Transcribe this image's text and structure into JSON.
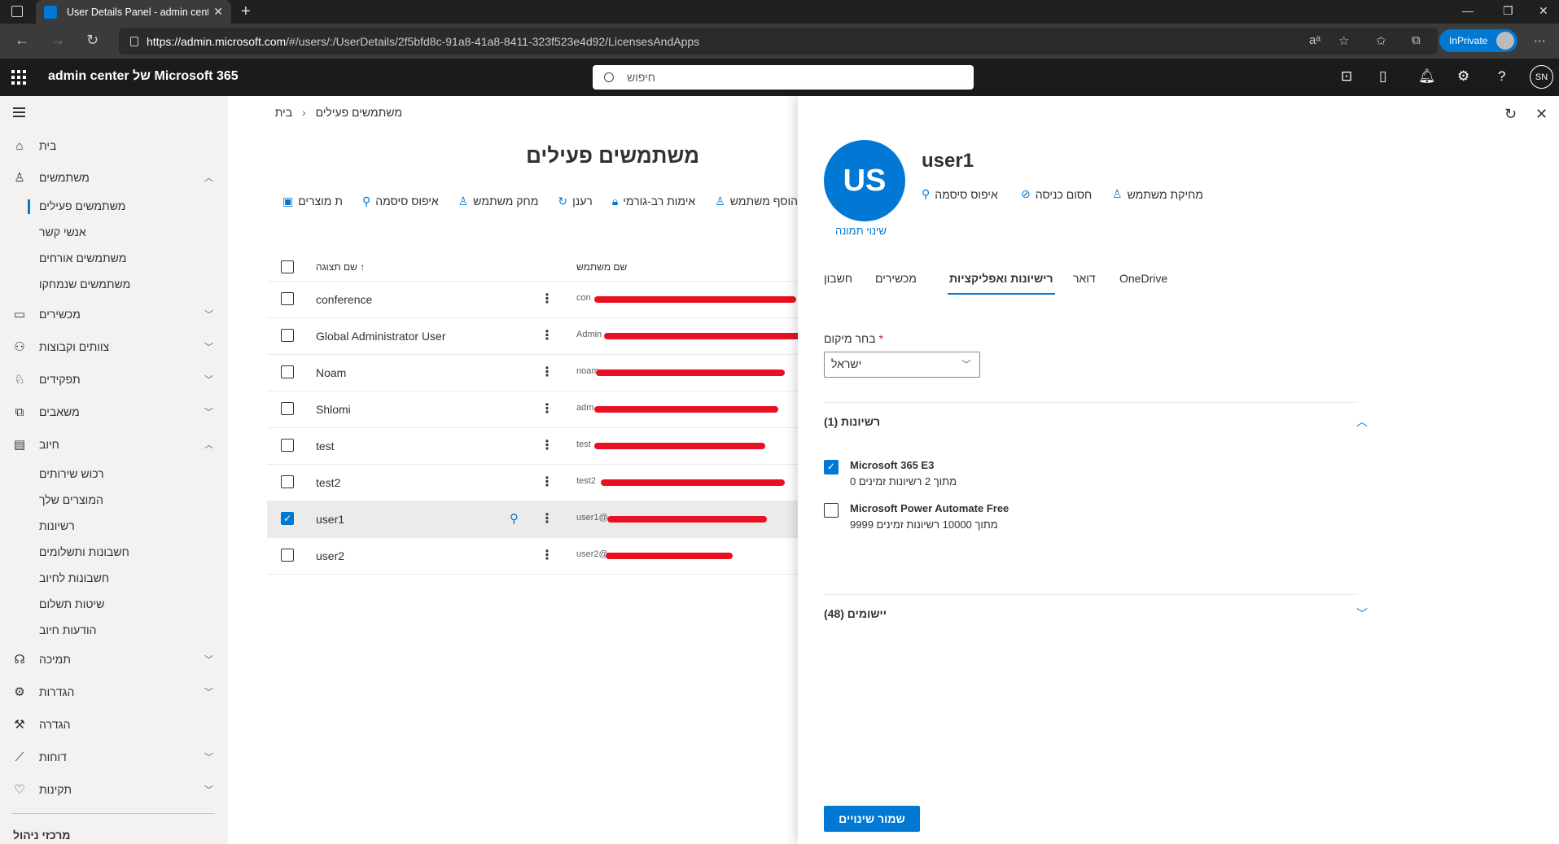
{
  "browser": {
    "tab_title": "User Details Panel - admin cente",
    "url_host": "https://admin.microsoft.com",
    "url_path": "/#/users/:/UserDetails/2f5bfd8c-91a8-41a8-8411-323f523e4d92/LicensesAndApps",
    "inprivate_label": "InPrivate"
  },
  "header": {
    "app_title": "admin center של Microsoft 365",
    "search_placeholder": "חיפוש",
    "avatar_initials": "SN"
  },
  "sidebar": {
    "home": "בית",
    "users": "משתמשים",
    "users_sub": [
      "משתמשים פעילים",
      "אנשי קשר",
      "משתמשים אורחים",
      "משתמשים שנמחקו"
    ],
    "devices": "מכשירים",
    "teams": "צוותים וקבוצות",
    "roles": "תפקידים",
    "resources": "משאבים",
    "billing": "חיוב",
    "billing_sub": [
      "רכוש שירותים",
      "המוצרים שלך",
      "רשיונות",
      "חשבונות ותשלומים",
      "חשבונות לחיוב",
      "שיטות תשלום",
      "הודעות חיוב"
    ],
    "support": "תמיכה",
    "settings": "הגדרות",
    "setup": "הגדרה",
    "reports": "דוחות",
    "health": "תקינות",
    "admin_centers": "מרכזי ניהול"
  },
  "main": {
    "breadcrumb_home": "בית",
    "breadcrumb_current": "משתמשים פעילים",
    "title": "משתמשים פעילים",
    "commands": [
      "הוסף משתמש",
      "אימות רב-גורמי",
      "רענן",
      "מחק משתמש",
      "איפוס סיסמה",
      "ת מוצרים"
    ],
    "col_display_name": "שם תצוגה",
    "col_username": "שם משתמש",
    "rows": [
      {
        "name": "conference",
        "username": "con"
      },
      {
        "name": "Global Administrator User",
        "username": "Admin"
      },
      {
        "name": "Noam",
        "username": "noam"
      },
      {
        "name": "Shlomi",
        "username": "adm"
      },
      {
        "name": "test",
        "username": "test"
      },
      {
        "name": "test2",
        "username": "test2"
      },
      {
        "name": "user1",
        "username": "user1@"
      },
      {
        "name": "user2",
        "username": "user2@"
      }
    ]
  },
  "panel": {
    "avatar_initials": "US",
    "change_photo": "שינוי תמונה",
    "user_name": "user1",
    "actions": [
      "איפוס סיסמה",
      "חסום כניסה",
      "מחיקת משתמש"
    ],
    "tabs": [
      "חשבון",
      "מכשירים",
      "רישיונות ואפליקציות",
      "דואר",
      "OneDrive"
    ],
    "active_tab": "רישיונות ואפליקציות",
    "location_label": "בחר מיקום",
    "location_value": "ישראל",
    "licenses_header": "רשיונות (1)",
    "licenses": [
      {
        "name": "Microsoft 365 E3",
        "sub": "0 מתוך 2 רשיונות זמינים",
        "checked": true
      },
      {
        "name": "Microsoft Power Automate Free",
        "sub": "9999 מתוך 10000 רשיונות זמינים",
        "checked": false
      }
    ],
    "apps_header": "יישומים (48)",
    "save_label": "שמור שינויים"
  },
  "colors": {
    "accent": "#0078d4",
    "redaction": "#e81123"
  }
}
